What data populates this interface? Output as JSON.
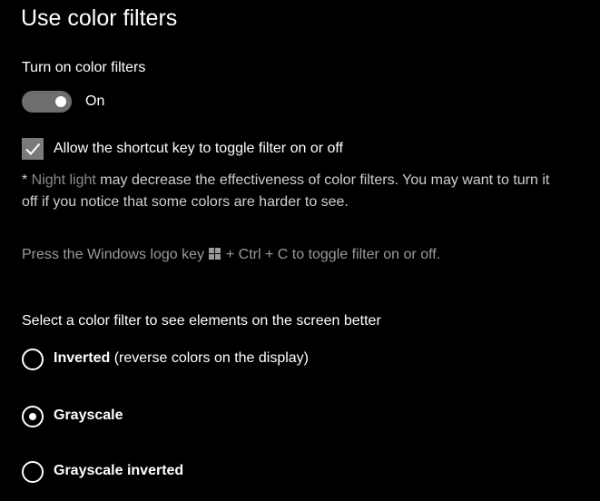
{
  "page": {
    "title": "Use color filters"
  },
  "color_filters_toggle": {
    "label": "Turn on color filters",
    "state": "On",
    "on": true
  },
  "shortcut_checkbox": {
    "label": "Allow the shortcut key to toggle filter on or off",
    "checked": true
  },
  "note": {
    "prefix": "* ",
    "link": "Night light",
    "text": " may decrease the effectiveness of color filters. You may want to turn it off if you notice that some colors are harder to see."
  },
  "shortcut_hint": {
    "before": "Press the Windows logo key ",
    "after": " + Ctrl + C to toggle filter on or off.",
    "icon": "windows-logo-icon"
  },
  "filter_selection": {
    "prompt": "Select a color filter to see elements on the screen better",
    "options": [
      {
        "name": "Inverted",
        "description": " (reverse colors on the display)",
        "selected": false
      },
      {
        "name": "Grayscale",
        "description": "",
        "selected": true
      },
      {
        "name": "Grayscale inverted",
        "description": "",
        "selected": false
      }
    ]
  },
  "colors": {
    "background": "#000000",
    "text": "#ffffff",
    "muted_text": "#9a9a9a",
    "toggle_track": "#6e6e6e",
    "checkbox_fill": "#7a7a7a"
  }
}
